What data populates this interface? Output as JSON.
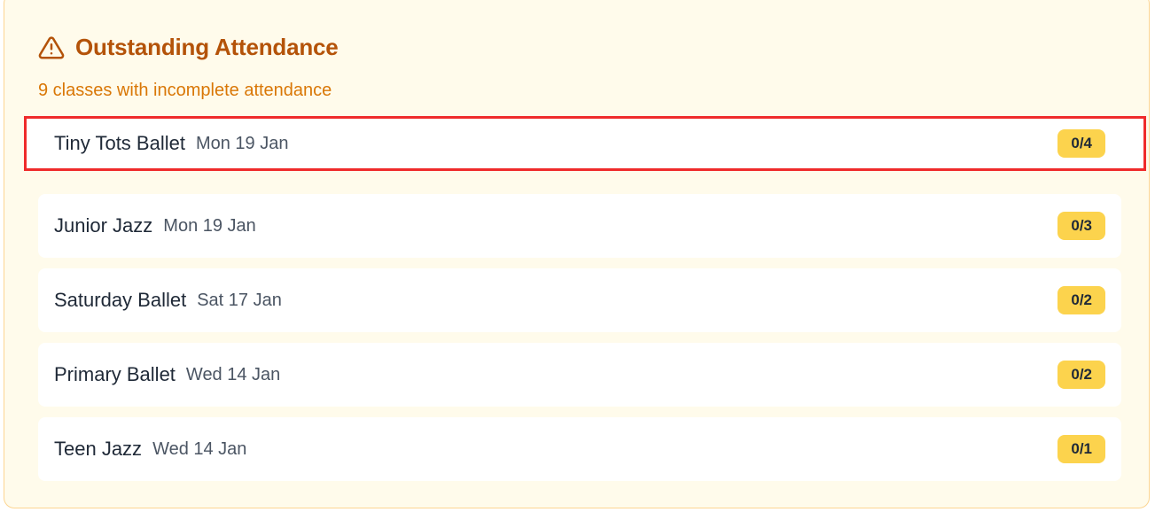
{
  "panel": {
    "title": "Outstanding Attendance",
    "subtitle": "9 classes with incomplete attendance",
    "icon": "warning-triangle-icon",
    "colors": {
      "title": "#b45309",
      "subtitle": "#d97706",
      "background": "#fffbeb",
      "badge": "#fcd34d",
      "highlight": "#ef2b2b"
    }
  },
  "classes": [
    {
      "name": "Tiny Tots Ballet",
      "date": "Mon 19 Jan",
      "count": "0/4"
    },
    {
      "name": "Junior Jazz",
      "date": "Mon 19 Jan",
      "count": "0/3"
    },
    {
      "name": "Saturday Ballet",
      "date": "Sat 17 Jan",
      "count": "0/2"
    },
    {
      "name": "Primary Ballet",
      "date": "Wed 14 Jan",
      "count": "0/2"
    },
    {
      "name": "Teen Jazz",
      "date": "Wed 14 Jan",
      "count": "0/1"
    }
  ]
}
